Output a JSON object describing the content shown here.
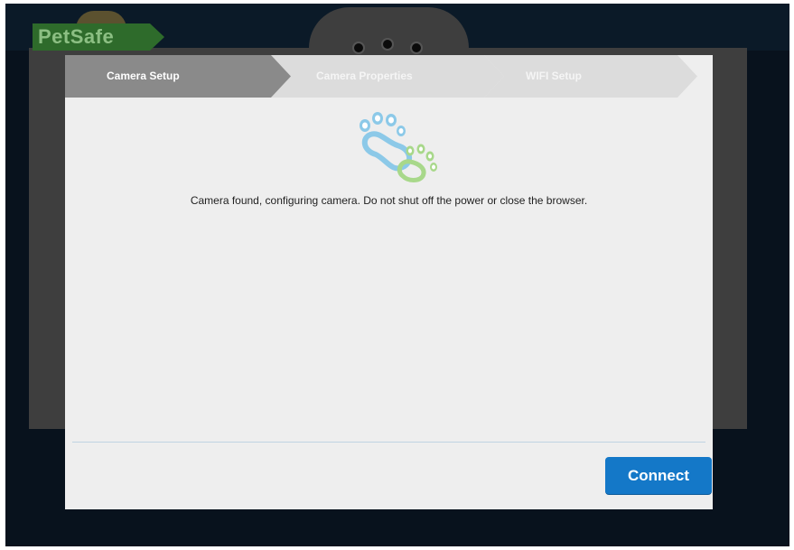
{
  "app": {
    "logo_text": "PetSafe"
  },
  "wizard": {
    "steps": [
      {
        "label": "Camera Setup",
        "state": "active"
      },
      {
        "label": "Camera Properties",
        "state": "inactive"
      },
      {
        "label": "WIFI Setup",
        "state": "inactive"
      }
    ]
  },
  "main": {
    "status_message": "Camera found, configuring camera. Do not shut off the power or close the browser.",
    "logo_icon": "paw-prints-icon"
  },
  "footer": {
    "connect_label": "Connect"
  },
  "colors": {
    "accent": "#1478c8",
    "active_step": "#8a8a8a",
    "inactive_step": "#dcdcdc",
    "paw_blue": "#8cc9e8",
    "paw_green": "#a8d88a"
  }
}
